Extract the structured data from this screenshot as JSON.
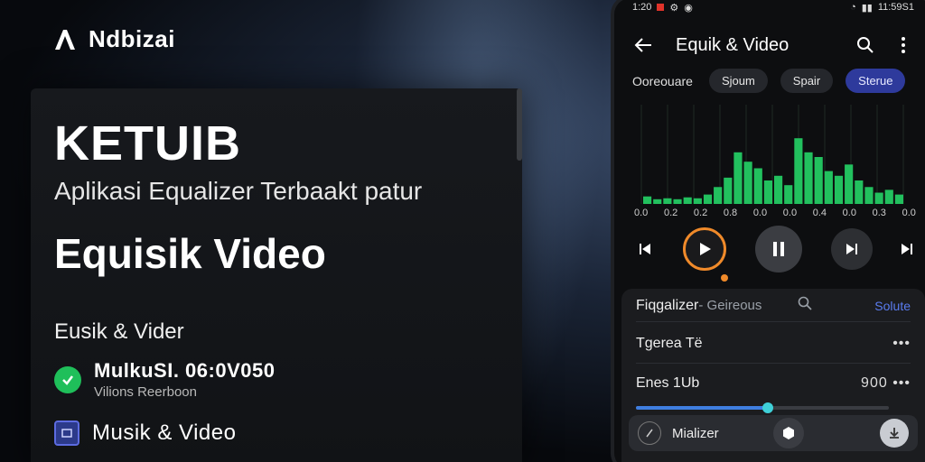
{
  "brand": {
    "name": "Ndbizai"
  },
  "card": {
    "title": "KETUIB",
    "subtitle": "Aplikasi Equalizer Terbaakt patur",
    "headline": "Equisik Video",
    "section_label": "Eusik & Vider",
    "items": [
      {
        "main": "MulkuSI. 06:0V050",
        "sub": "Vilions Reerboon",
        "icon": "check-badge-icon"
      },
      {
        "main": "Musik & Video",
        "sub": "",
        "icon": "media-box-icon"
      }
    ]
  },
  "phone": {
    "status": {
      "time_left": "1:20",
      "time_right": "11:59S1"
    },
    "appbar": {
      "title": "Equik & Video"
    },
    "chips": {
      "label": "Ooreouare",
      "items": [
        {
          "label": "Sjoum",
          "active": false
        },
        {
          "label": "Spair",
          "active": false
        },
        {
          "label": "Sterue",
          "active": true
        }
      ]
    },
    "ticks": [
      "0.0",
      "0.2",
      "0.2",
      "0.8",
      "0.0",
      "0.0",
      "0.4",
      "0.0",
      "0.3",
      "0.0"
    ],
    "bars": [
      0.08,
      0.05,
      0.06,
      0.05,
      0.07,
      0.06,
      0.1,
      0.18,
      0.28,
      0.55,
      0.45,
      0.38,
      0.25,
      0.3,
      0.2,
      0.7,
      0.55,
      0.5,
      0.35,
      0.3,
      0.42,
      0.25,
      0.18,
      0.12,
      0.15,
      0.1
    ],
    "panel": {
      "row1_title": "Fiqgalizer",
      "row1_sub": "- Geireous",
      "row1_link": "Solute",
      "row2_title": "Tgerea Të",
      "row3_title": "Enes 1Ub",
      "row3_value": "900",
      "slider_level": 0.52,
      "bottom_label": "Mializer"
    },
    "colors": {
      "bar": "#22c05e",
      "accent": "#2e3a9c",
      "orange": "#f08a2a"
    }
  }
}
